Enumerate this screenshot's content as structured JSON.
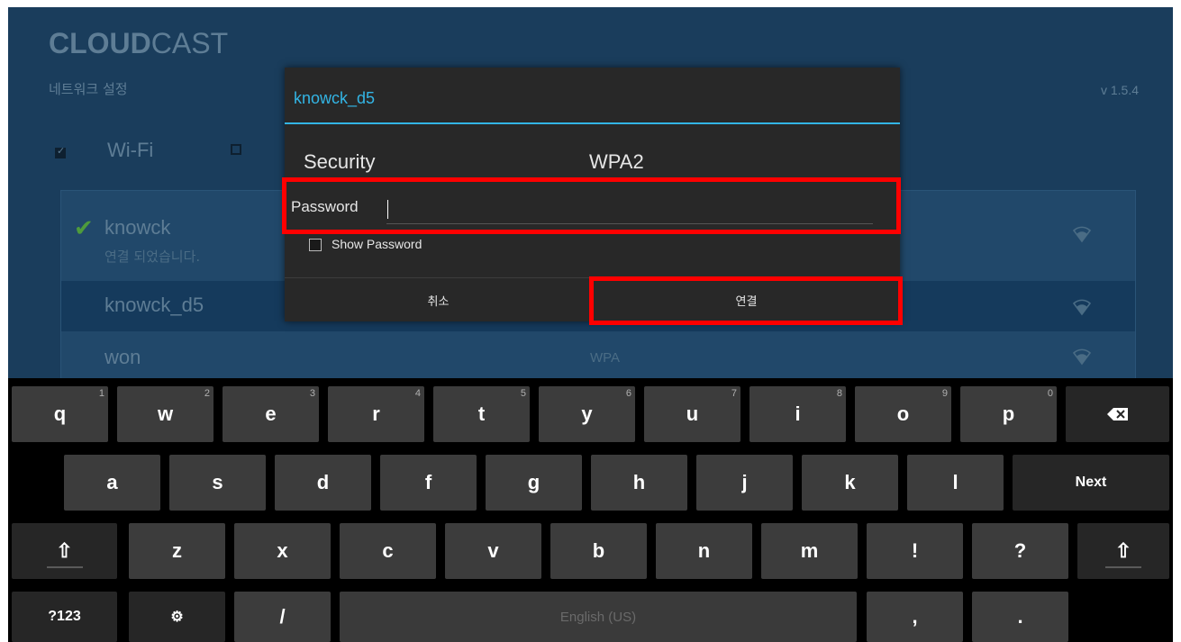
{
  "app": {
    "brand_bold": "CLOUD",
    "brand_light": "CAST",
    "subtitle": "네트워크 설정",
    "version": "v 1.5.4",
    "wifi_label": "Wi-Fi"
  },
  "networks": [
    {
      "name": "knowck",
      "status": "연결 되었습니다.",
      "security": "",
      "connected": true
    },
    {
      "name": "knowck_d5",
      "status": "",
      "security": "",
      "selected": true
    },
    {
      "name": "won",
      "status": "",
      "security": "WPA"
    }
  ],
  "dialog": {
    "title": "knowck_d5",
    "security_label": "Security",
    "security_value": "WPA2",
    "password_label": "Password",
    "password_value": "",
    "show_password_label": "Show Password",
    "show_password_checked": false,
    "cancel_label": "취소",
    "connect_label": "연결"
  },
  "keyboard": {
    "row1": [
      {
        "label": "q",
        "hint": "1"
      },
      {
        "label": "w",
        "hint": "2"
      },
      {
        "label": "e",
        "hint": "3"
      },
      {
        "label": "r",
        "hint": "4"
      },
      {
        "label": "t",
        "hint": "5"
      },
      {
        "label": "y",
        "hint": "6"
      },
      {
        "label": "u",
        "hint": "7"
      },
      {
        "label": "i",
        "hint": "8"
      },
      {
        "label": "o",
        "hint": "9"
      },
      {
        "label": "p",
        "hint": "0"
      }
    ],
    "row2": [
      "a",
      "s",
      "d",
      "f",
      "g",
      "h",
      "j",
      "k",
      "l"
    ],
    "row3": [
      "z",
      "x",
      "c",
      "v",
      "b",
      "n",
      "m",
      "!",
      "?"
    ],
    "next_label": "Next",
    "sym_label": "?123",
    "settings_glyph": "⚙",
    "slash_label": "/",
    "space_label": "English (US)",
    "comma_label": ",",
    "period_label": ".",
    "shift_glyph": "⇧",
    "backspace_glyph": "⌫"
  },
  "colors": {
    "accent": "#33b5e5",
    "highlight": "#ff0000",
    "background": "#1a3d5c"
  }
}
